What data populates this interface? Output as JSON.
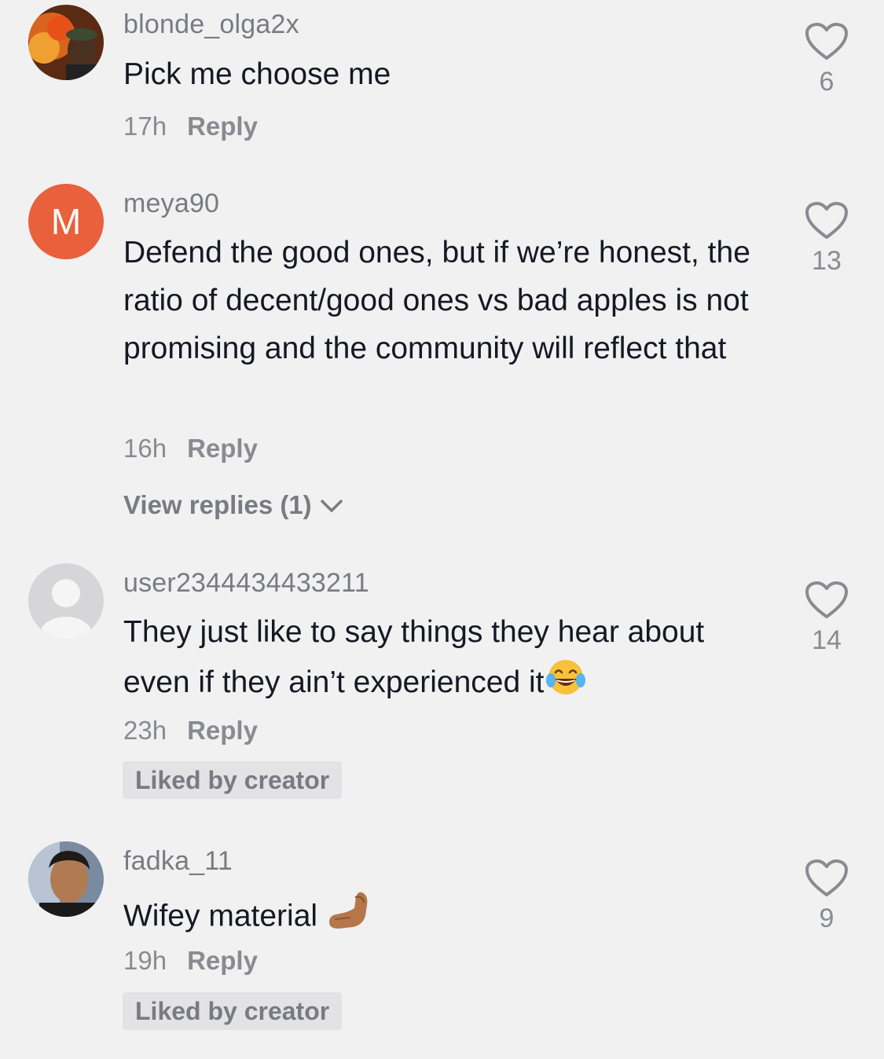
{
  "comments": [
    {
      "username": "blonde_olga2x",
      "text": "Pick me choose me",
      "time": "17h",
      "reply_label": "Reply",
      "likes": "6",
      "avatar": "photo-fire-background"
    },
    {
      "username": "meya90",
      "avatar_initial": "M",
      "text": "Defend the good ones, but if we’re honest, the ratio of decent/good ones vs bad apples is not promising and the community will reflect that",
      "time": "16h",
      "reply_label": "Reply",
      "likes": "13",
      "view_replies": "View replies (1)"
    },
    {
      "username": "user2344434433211",
      "text": "They just like to say things they hear about even if they ain’t experienced it",
      "emoji": "tears-of-joy",
      "time": "23h",
      "reply_label": "Reply",
      "likes": "14",
      "badge": "Liked by creator",
      "avatar": "default-user-icon"
    },
    {
      "username": "fadka_11",
      "text": "Wifey material",
      "emoji": "pinched-fingers",
      "time": "19h",
      "reply_label": "Reply",
      "likes": "9",
      "badge": "Liked by creator",
      "avatar": "photo-person"
    }
  ],
  "colors": {
    "background": "#f1f1f2",
    "secondary_text": "#8a8b91",
    "avatar_initial_bg": "#e8603c"
  }
}
